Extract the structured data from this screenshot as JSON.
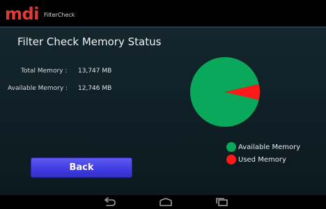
{
  "app": {
    "logo_text": "mdi",
    "name": "FilterCheck"
  },
  "page": {
    "title": "Filter Check Memory Status"
  },
  "memory": {
    "total_label": "Total Memory :",
    "total_value": "13,747 MB",
    "available_label": "Available Memory :",
    "available_value": "12,746 MB"
  },
  "pie": {
    "slices": [
      {
        "name": "Available Memory",
        "value": 12746,
        "color": "#0aa85a"
      },
      {
        "name": "Used Memory",
        "value": 1001,
        "color": "#ff1a1a"
      }
    ]
  },
  "legend": {
    "available": {
      "label": "Available Memory",
      "color": "#0aa85a"
    },
    "used": {
      "label": "Used Memory",
      "color": "#ff1a1a"
    }
  },
  "actions": {
    "back_label": "Back"
  },
  "nav": {
    "back_icon": "nav-back-icon",
    "home_icon": "nav-home-icon",
    "recents_icon": "nav-recents-icon"
  }
}
